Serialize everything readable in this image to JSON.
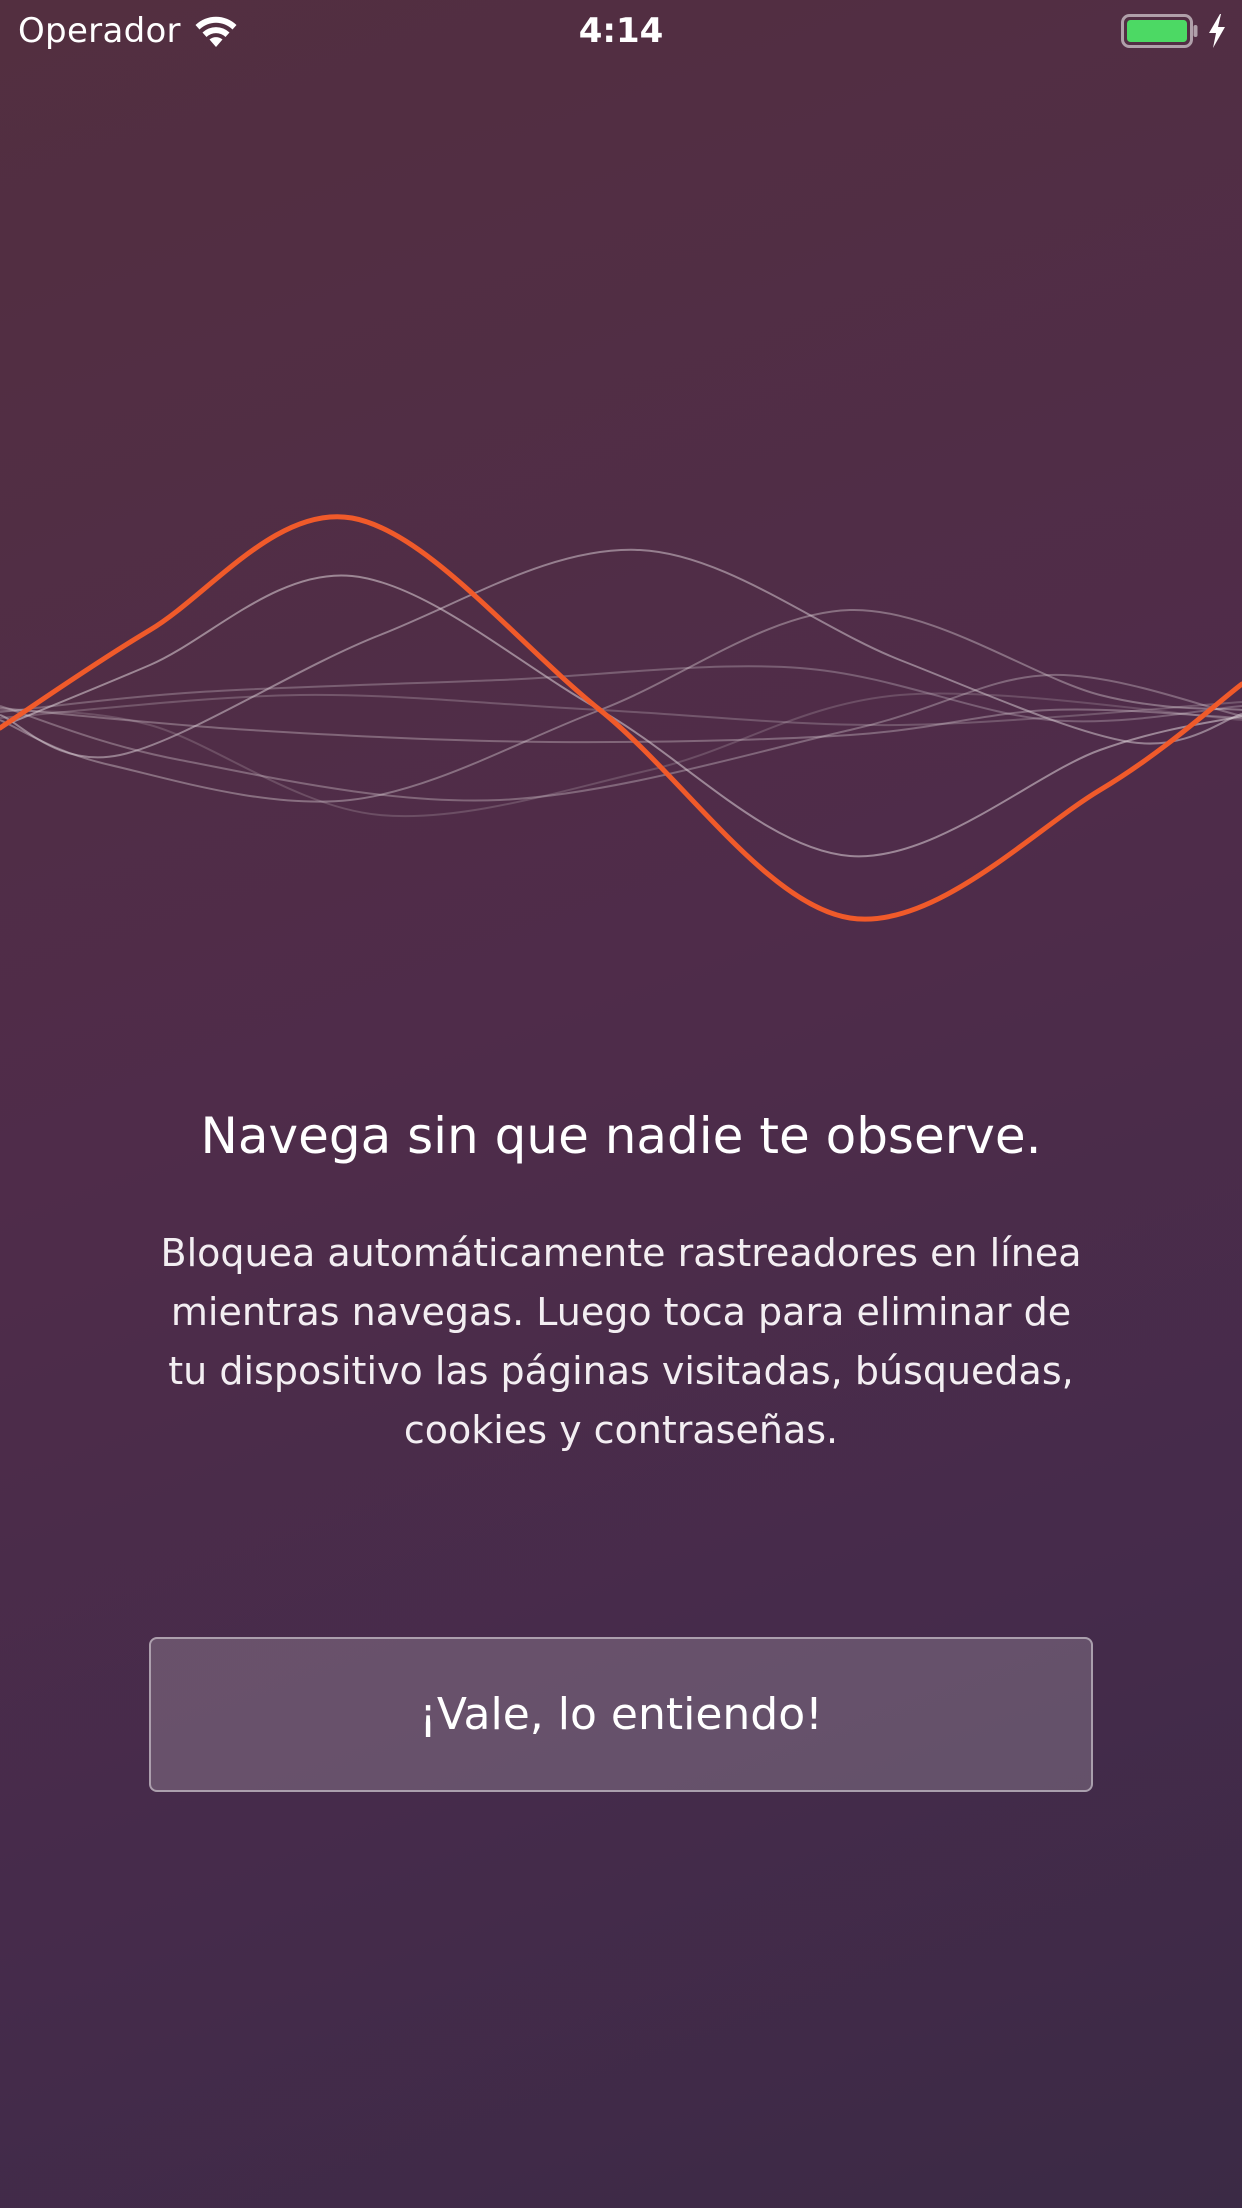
{
  "status_bar": {
    "carrier": "Operador",
    "time": "4:14",
    "wifi_icon": "wifi-icon",
    "battery_icon": "battery-icon",
    "charging_icon": "charging-bolt-icon",
    "battery_color": "#4cd964"
  },
  "illustration": {
    "icon": "sound-wave-illustration",
    "accent_color": "#f05a2a"
  },
  "onboarding": {
    "headline": "Navega sin que nadie te observe.",
    "description_lines": [
      "Bloquea automáticamente rastreadores en línea",
      "mientras navegas. Luego toca para eliminar de",
      "tu dispositivo las páginas visitadas, búsquedas,",
      "cookies y contraseñas."
    ],
    "confirm_button_label": "¡Vale, lo entiendo!"
  }
}
